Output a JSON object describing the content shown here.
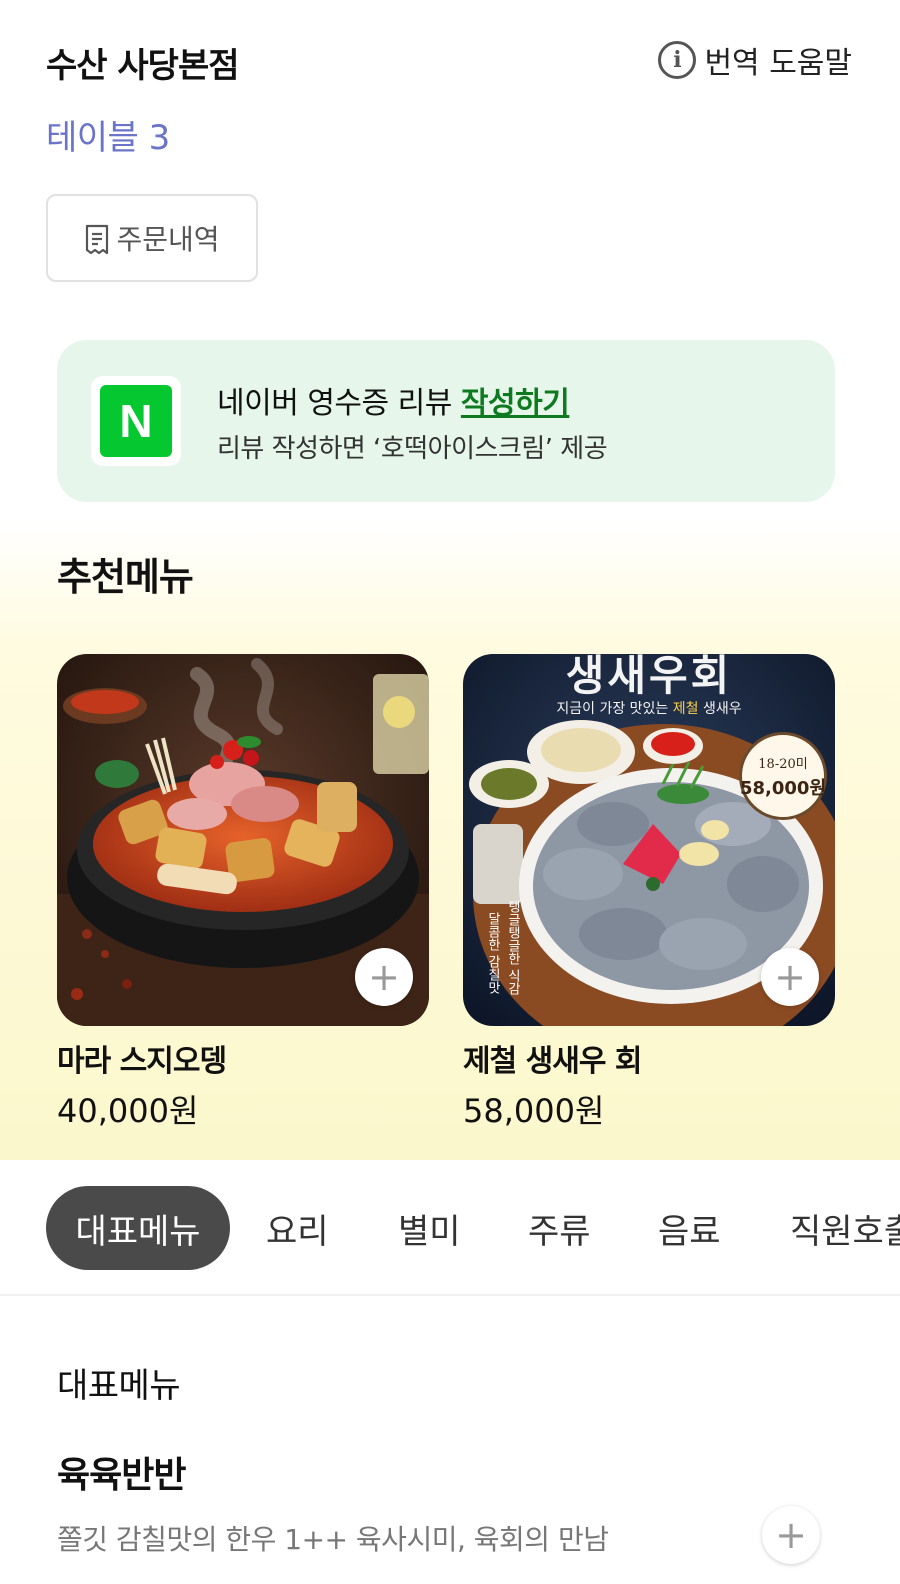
{
  "header": {
    "store_name": "수산 사당본점",
    "translate_help": "번역 도움말",
    "info_icon": "i",
    "table_label": "테이블 3"
  },
  "order_history": {
    "label": "주문내역",
    "icon": "receipt-icon"
  },
  "review_banner": {
    "logo_letter": "N",
    "title_prefix": "네이버 영수증 리뷰",
    "title_link": "작성하기",
    "subtitle": "리뷰 작성하면 ‘호떡아이스크림’ 제공"
  },
  "recommended": {
    "title": "추천메뉴",
    "items": [
      {
        "name": "마라 스지오뎅",
        "price": "40,000원"
      },
      {
        "name": "제철 생새우 회",
        "price": "58,000원",
        "image_headline": "생새우회",
        "image_tagline_1": "지금이 가장 맛있는",
        "image_tagline_hl": "제철",
        "image_tagline_2": "생새우",
        "badge_count": "18-20미",
        "badge_price": "58,000원",
        "vertical_text_1": "달콤한 감칠맛",
        "vertical_text_2": "탱글탱글한 식감"
      }
    ]
  },
  "tabs": [
    {
      "label": "대표메뉴",
      "active": true
    },
    {
      "label": "요리"
    },
    {
      "label": "별미"
    },
    {
      "label": "주류"
    },
    {
      "label": "음료"
    },
    {
      "label": "직원호출"
    }
  ],
  "menu": {
    "section_label": "대표메뉴",
    "items": [
      {
        "name": "육육반반",
        "description": "쫄깃 감칠맛의 한우 1++ 육사시미, 육회의 만남"
      }
    ]
  },
  "add_symbol": "+",
  "colors": {
    "table_label": "#6a74c9",
    "review_banner_bg": "#e6f6ea",
    "review_link": "#0d7a1f",
    "naver_green": "#05c72f",
    "active_tab_bg": "#4a4a4a",
    "recommend_bg": "#fbf7cc"
  }
}
